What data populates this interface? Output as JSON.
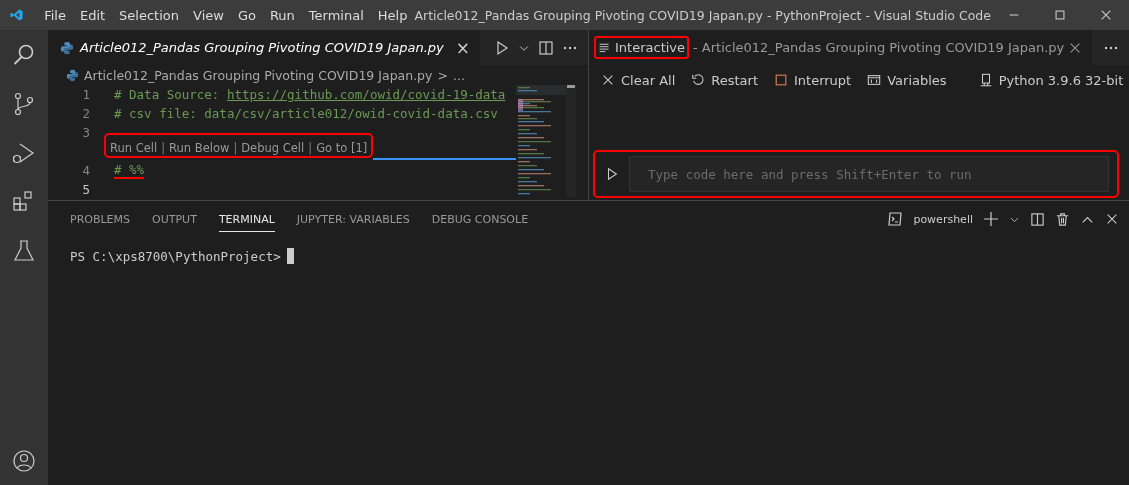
{
  "title_bar": {
    "menu": [
      "File",
      "Edit",
      "Selection",
      "View",
      "Go",
      "Run",
      "Terminal",
      "Help"
    ],
    "title": "Article012_Pandas Grouping Pivoting COVID19 Japan.py - PythonProject - Visual Studio Code"
  },
  "activity_bar": {
    "items": [
      {
        "kind": "search"
      },
      {
        "kind": "source-control"
      },
      {
        "kind": "run-debug"
      },
      {
        "kind": "extensions"
      },
      {
        "kind": "testing"
      }
    ],
    "bottom": [
      {
        "kind": "account"
      }
    ]
  },
  "editor": {
    "tab": {
      "label": "Article012_Pandas Grouping Pivoting COVID19 Japan.py",
      "selected": true,
      "preview": true,
      "close": "×"
    },
    "breadcrumb": {
      "file": "Article012_Pandas Grouping Pivoting COVID19 Japan.py",
      "separator": ">",
      "more": "..."
    },
    "lines": [
      {
        "number": "1",
        "current": false,
        "segments": [
          {
            "kind": "comment",
            "text": "# Data Source: "
          },
          {
            "kind": "link",
            "text": "https://github.com/owid/covid-19-data"
          }
        ]
      },
      {
        "number": "2",
        "current": false,
        "segments": [
          {
            "kind": "comment",
            "text": "# csv file: data/csv/article012/owid-covid-data.csv"
          }
        ]
      },
      {
        "number": "3",
        "current": false
      },
      {
        "kind": "codelens",
        "highlighted": true,
        "items": [
          {
            "kind": "action",
            "text": "Run Cell"
          },
          {
            "kind": "separator",
            "text": "|"
          },
          {
            "kind": "action",
            "text": "Run Below"
          },
          {
            "kind": "separator",
            "text": "|"
          },
          {
            "kind": "action",
            "text": "Debug Cell"
          },
          {
            "kind": "separator",
            "text": "|"
          },
          {
            "kind": "action",
            "text": "Go to [1]"
          }
        ]
      },
      {
        "number": "4",
        "current": false,
        "underlined": true,
        "segments": [
          {
            "kind": "comment",
            "text": "# %%"
          }
        ]
      },
      {
        "number": "5",
        "current": true
      }
    ]
  },
  "interactive": {
    "tab": {
      "title": "Interactive",
      "description": "- Article012_Pandas Grouping Pivoting COVID19 Japan.py",
      "selected": true,
      "highlighted": true
    },
    "toolbar": [
      {
        "kind": "clear",
        "label": "Clear All"
      },
      {
        "kind": "restart",
        "label": "Restart"
      },
      {
        "kind": "interrupt",
        "label": "Interrupt"
      },
      {
        "kind": "variables",
        "label": "Variables"
      },
      {
        "kind": "more"
      }
    ],
    "kernel": "Python 3.9.6 32-bit",
    "input": {
      "placeholder": "Type code here and press Shift+Enter to run",
      "highlighted": true
    }
  },
  "panel": {
    "tabs": [
      {
        "label": "PROBLEMS",
        "selected": false
      },
      {
        "label": "OUTPUT",
        "selected": false
      },
      {
        "label": "TERMINAL",
        "selected": true
      },
      {
        "label": "JUPYTER: VARIABLES",
        "selected": false
      },
      {
        "label": "DEBUG CONSOLE",
        "selected": false
      }
    ],
    "terminal_name": "powershell",
    "prompt": "PS C:\\xps8700\\PythonProject>"
  }
}
